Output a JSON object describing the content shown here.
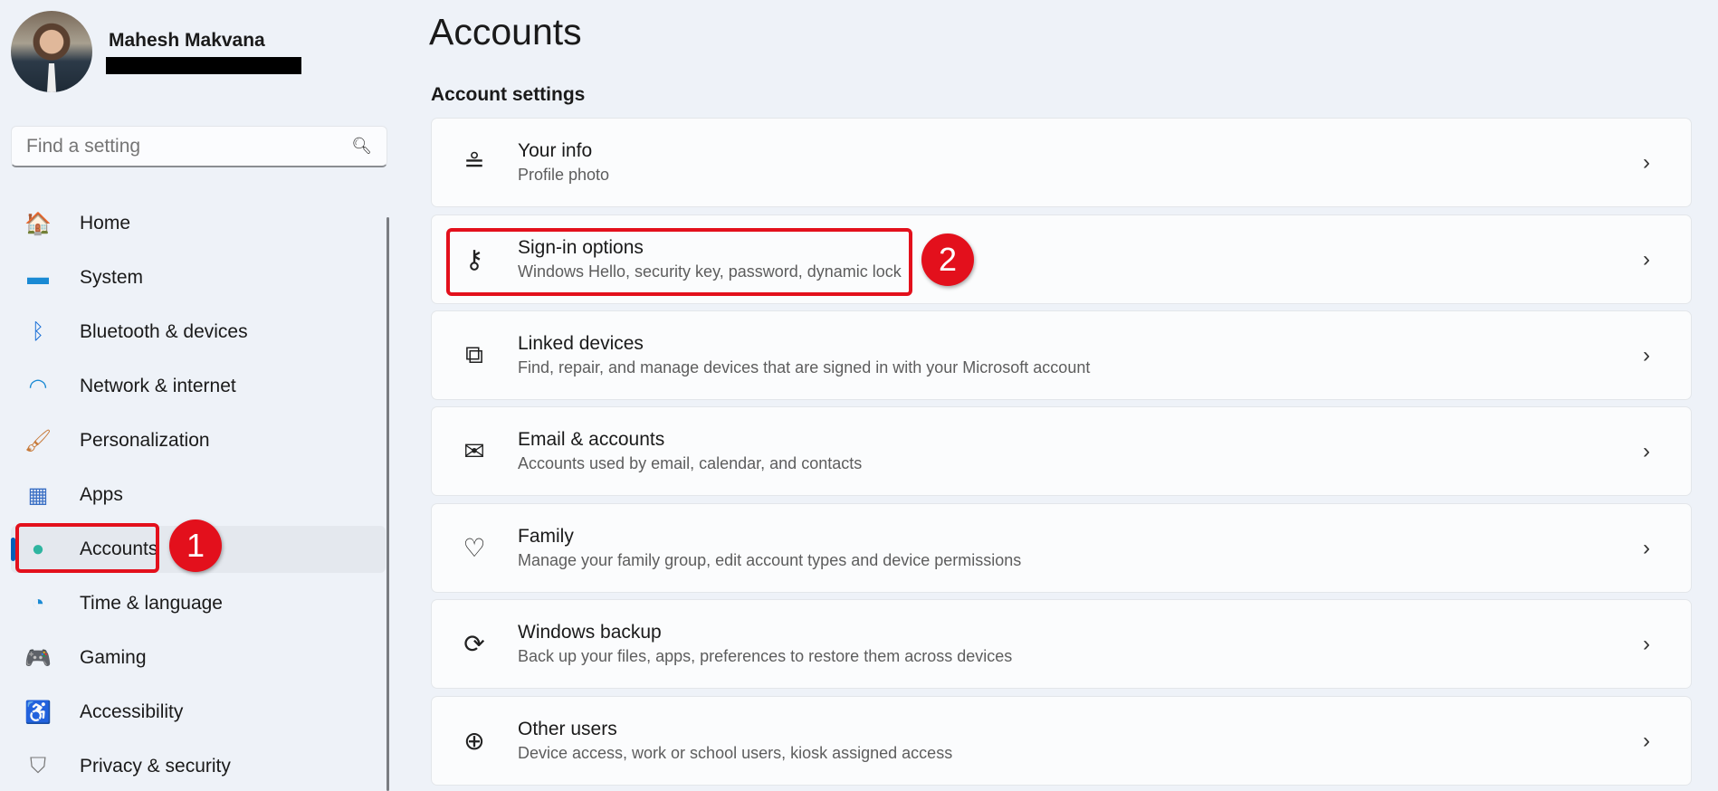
{
  "user": {
    "name": "Mahesh Makvana"
  },
  "search": {
    "placeholder": "Find a setting"
  },
  "nav": [
    {
      "label": "Home",
      "icon": "home-icon",
      "glyph": "🏠"
    },
    {
      "label": "System",
      "icon": "monitor-icon",
      "glyph": "▬"
    },
    {
      "label": "Bluetooth & devices",
      "icon": "bluetooth-icon",
      "glyph": "ᛒ"
    },
    {
      "label": "Network & internet",
      "icon": "wifi-icon",
      "glyph": "◠"
    },
    {
      "label": "Personalization",
      "icon": "brush-icon",
      "glyph": "🖌"
    },
    {
      "label": "Apps",
      "icon": "apps-icon",
      "glyph": "▦"
    },
    {
      "label": "Accounts",
      "icon": "person-icon",
      "glyph": "●"
    },
    {
      "label": "Time & language",
      "icon": "globe-clock-icon",
      "glyph": "◔"
    },
    {
      "label": "Gaming",
      "icon": "gamepad-icon",
      "glyph": "🎮"
    },
    {
      "label": "Accessibility",
      "icon": "accessibility-icon",
      "glyph": "♿"
    },
    {
      "label": "Privacy & security",
      "icon": "shield-icon",
      "glyph": "⛉"
    }
  ],
  "page": {
    "title": "Accounts",
    "section": "Account settings"
  },
  "cards": [
    {
      "title": "Your info",
      "subtitle": "Profile photo",
      "icon": "person-list-icon",
      "glyph": "≗"
    },
    {
      "title": "Sign-in options",
      "subtitle": "Windows Hello, security key, password, dynamic lock",
      "icon": "key-icon",
      "glyph": "⚷"
    },
    {
      "title": "Linked devices",
      "subtitle": "Find, repair, and manage devices that are signed in with your Microsoft account",
      "icon": "devices-icon",
      "glyph": "⧉"
    },
    {
      "title": "Email & accounts",
      "subtitle": "Accounts used by email, calendar, and contacts",
      "icon": "mail-icon",
      "glyph": "✉"
    },
    {
      "title": "Family",
      "subtitle": "Manage your family group, edit account types and device permissions",
      "icon": "family-heart-icon",
      "glyph": "♡"
    },
    {
      "title": "Windows backup",
      "subtitle": "Back up your files, apps, preferences to restore them across devices",
      "icon": "backup-icon",
      "glyph": "⟳"
    },
    {
      "title": "Other users",
      "subtitle": "Device access, work or school users, kiosk assigned access",
      "icon": "add-user-icon",
      "glyph": "⊕"
    }
  ],
  "annotations": {
    "step1": "1",
    "step2": "2"
  },
  "colors": {
    "accent": "#005fb8",
    "annotation": "#e3101c"
  }
}
